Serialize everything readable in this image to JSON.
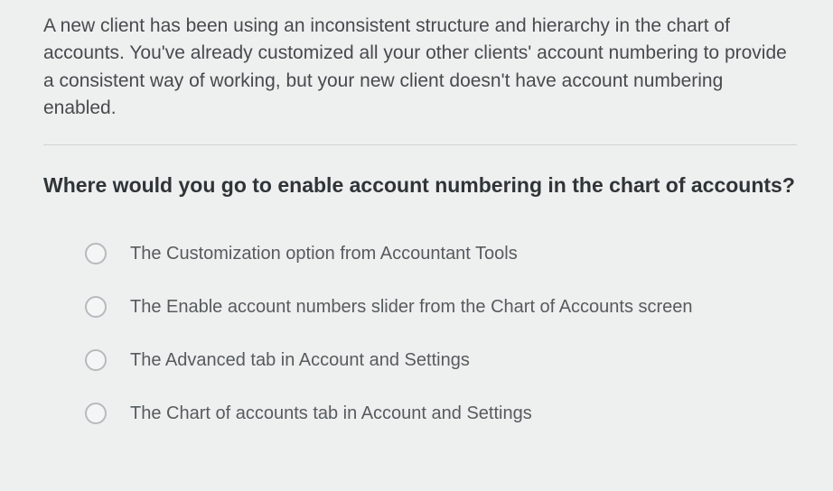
{
  "context": "A new client has been using an inconsistent structure and hierarchy in the chart of accounts. You've already customized all your other clients' account numbering to provide a consistent way of working, but your new client doesn't have account numbering enabled.",
  "question": "Where would you go to enable account numbering in the chart of accounts?",
  "options": [
    {
      "label": "The Customization option from Accountant Tools"
    },
    {
      "label": "The Enable account numbers slider from the Chart of Accounts screen"
    },
    {
      "label": "The Advanced tab in Account and Settings"
    },
    {
      "label": "The Chart of accounts tab in Account and Settings"
    }
  ]
}
